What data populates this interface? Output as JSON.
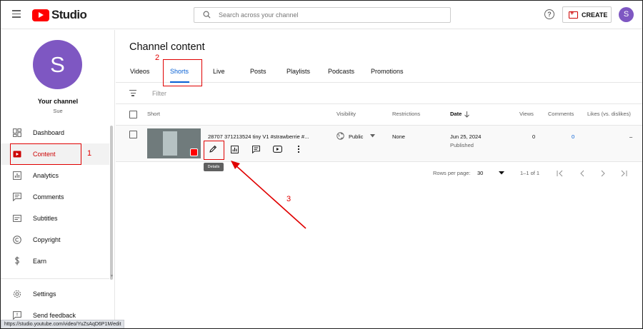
{
  "topbar": {
    "logo_text": "Studio",
    "search_placeholder": "Search across your channel",
    "help_glyph": "?",
    "create_label": "CREATE",
    "avatar_letter": "S"
  },
  "sidebar": {
    "avatar_letter": "S",
    "channel_title": "Your channel",
    "channel_name": "Sue",
    "items": [
      {
        "label": "Dashboard",
        "icon": "dashboard-icon"
      },
      {
        "label": "Content",
        "icon": "content-icon"
      },
      {
        "label": "Analytics",
        "icon": "analytics-icon"
      },
      {
        "label": "Comments",
        "icon": "comments-icon"
      },
      {
        "label": "Subtitles",
        "icon": "subtitles-icon"
      },
      {
        "label": "Copyright",
        "icon": "copyright-icon"
      },
      {
        "label": "Earn",
        "icon": "earn-icon"
      },
      {
        "label": "Settings",
        "icon": "settings-icon"
      },
      {
        "label": "Send feedback",
        "icon": "feedback-icon"
      }
    ],
    "active_item": "Content"
  },
  "main": {
    "title": "Channel content",
    "tabs": [
      "Videos",
      "Shorts",
      "Live",
      "Posts",
      "Playlists",
      "Podcasts",
      "Promotions"
    ],
    "active_tab": "Shorts",
    "filter_label": "Filter",
    "columns": {
      "short": "Short",
      "visibility": "Visibility",
      "restrictions": "Restrictions",
      "date": "Date",
      "views": "Views",
      "comments": "Comments",
      "likes": "Likes (vs. dislikes)"
    },
    "rows": [
      {
        "title": "28707 371213524 tiny V1 #strawberrie #...",
        "visibility": "Public",
        "restrictions": "None",
        "date": "Jun 25, 2024",
        "date_status": "Published",
        "views": "0",
        "comments": "0",
        "likes": "–"
      }
    ],
    "row_action_icons": [
      "pencil-icon",
      "analytics-icon",
      "comments-icon",
      "youtube-icon",
      "more-vert-icon"
    ],
    "tooltip": "Details",
    "pagination": {
      "rows_per_page_label": "Rows per page:",
      "rows_per_page": "30",
      "range": "1–1 of 1"
    }
  },
  "annotations": {
    "step1": "1",
    "step2": "2",
    "step3": "3",
    "color": "#e00000"
  },
  "status_url": "https://studio.youtube.com/video/YuZsAqD6P1M/edit",
  "colors": {
    "brand_red": "#ff0000",
    "link_blue": "#065fd4",
    "avatar_purple": "#7e57c2"
  }
}
